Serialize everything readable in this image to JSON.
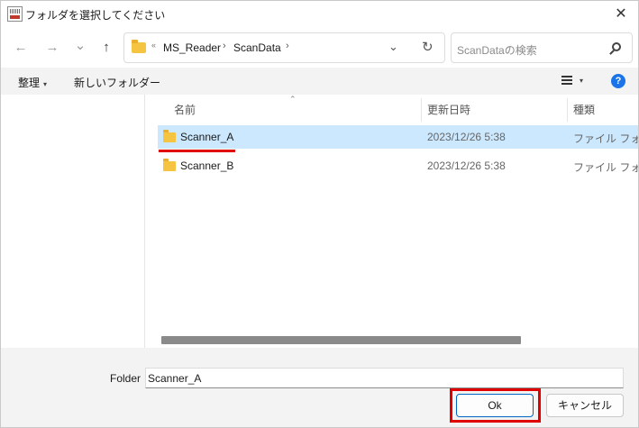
{
  "window": {
    "title": "フォルダを選択してください",
    "close_glyph": "✕"
  },
  "nav": {
    "back_glyph": "←",
    "forward_glyph": "→",
    "recent_glyph": "⌄",
    "up_glyph": "↑",
    "overflow_glyph": "«",
    "breadcrumbs": [
      "MS_Reader",
      "ScanData"
    ],
    "crumb_separator": "›",
    "dropdown_glyph": "⌄",
    "refresh_glyph": "↻",
    "search_placeholder": "ScanDataの検索"
  },
  "toolbar": {
    "organize_label": "整理",
    "caret_glyph": "▾",
    "new_folder_label": "新しいフォルダー",
    "help_glyph": "?"
  },
  "filelist": {
    "columns": [
      "名前",
      "更新日時",
      "種類"
    ],
    "sort_glyph": "⌃",
    "rows": [
      {
        "name": "Scanner_A",
        "modified": "2023/12/26 5:38",
        "type": "ファイル フォルダー",
        "selected": true
      },
      {
        "name": "Scanner_B",
        "modified": "2023/12/26 5:38",
        "type": "ファイル フォルダー",
        "selected": false
      }
    ]
  },
  "footer": {
    "folder_label": "Folder",
    "folder_value": "Scanner_A",
    "ok_label": "Ok",
    "cancel_label": "キャンセル"
  },
  "colors": {
    "selection": "#cce8ff",
    "highlight_red": "#e00000",
    "accent_blue": "#1a73e8",
    "folder_yellow": "#f5c542"
  }
}
